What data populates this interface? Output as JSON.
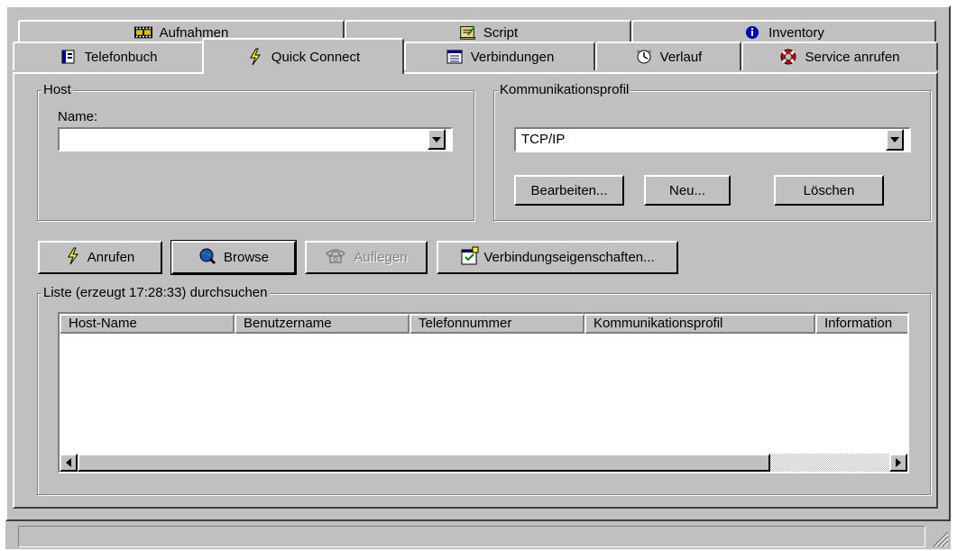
{
  "tabs_row_back": [
    {
      "label": "Aufnahmen",
      "icon": "film-icon"
    },
    {
      "label": "Script",
      "icon": "script-scroll-icon"
    },
    {
      "label": "Inventory",
      "icon": "info-icon"
    }
  ],
  "tabs_row_front": [
    {
      "label": "Telefonbuch",
      "icon": "phonebook-icon"
    },
    {
      "label": "Quick Connect",
      "icon": "lightning-icon",
      "active": true
    },
    {
      "label": "Verbindungen",
      "icon": "connections-list-icon"
    },
    {
      "label": "Verlauf",
      "icon": "clock-icon"
    },
    {
      "label": "Service anrufen",
      "icon": "lifebuoy-icon"
    }
  ],
  "host": {
    "legend": "Host",
    "name_label": "Name:",
    "name_value": ""
  },
  "profile": {
    "legend": "Kommunikationsprofil",
    "selected": "TCP/IP",
    "edit_button": "Bearbeiten...",
    "new_button": "Neu...",
    "delete_button": "Löschen"
  },
  "actions": {
    "call": "Anrufen",
    "browse": "Browse",
    "hangup": "Auflegen",
    "properties": "Verbindungseigenschaften..."
  },
  "list": {
    "legend": "Liste (erzeugt 17:28:33) durchsuchen",
    "columns": [
      "Host-Name",
      "Benutzername",
      "Telefonnummer",
      "Kommunikationsprofil",
      "Information"
    ]
  },
  "colors": {
    "face": "#c0c0c0",
    "highlight": "#ffffff",
    "shadow": "#808080",
    "dark": "#404040"
  }
}
